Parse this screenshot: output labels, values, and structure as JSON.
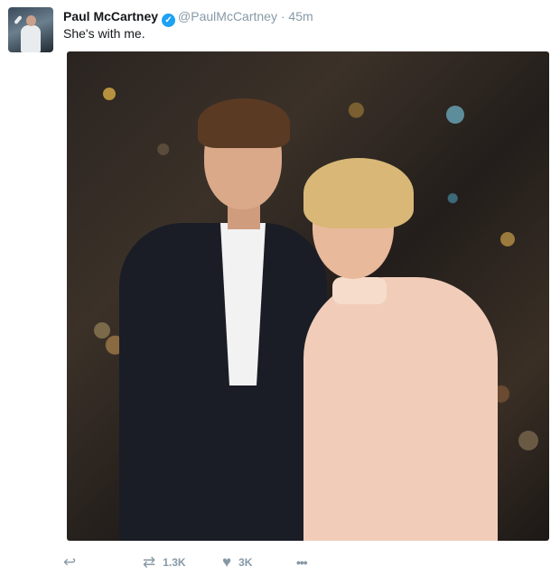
{
  "tweet": {
    "author_name": "Paul McCartney",
    "verified_icon": "verified-badge-icon",
    "handle": "@PaulMcCartney",
    "separator": "·",
    "timestamp": "45m",
    "text": "She's with me.",
    "media": {
      "description": "photo"
    },
    "actions": {
      "reply_icon": "reply-icon",
      "retweet_icon": "retweet-icon",
      "retweet_count": "1.3K",
      "like_icon": "heart-icon",
      "like_count": "3K",
      "more_icon": "more-icon"
    },
    "colors": {
      "verified": "#1da1f2",
      "muted": "#8899a6",
      "text": "#14171a"
    }
  }
}
